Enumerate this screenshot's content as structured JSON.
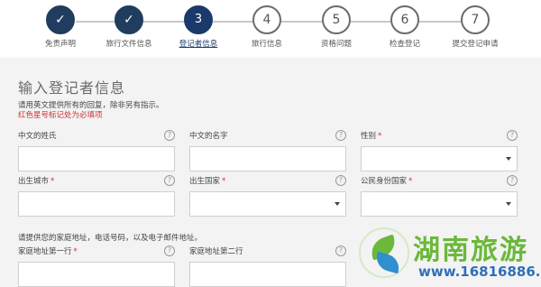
{
  "steps": [
    {
      "number": "✓",
      "label": "免责声明",
      "state": "done"
    },
    {
      "number": "✓",
      "label": "旅行文件信息",
      "state": "done"
    },
    {
      "number": "3",
      "label": "登记者信息",
      "state": "current"
    },
    {
      "number": "4",
      "label": "旅行信息",
      "state": "pending"
    },
    {
      "number": "5",
      "label": "资格问题",
      "state": "pending"
    },
    {
      "number": "6",
      "label": "检查登记",
      "state": "pending"
    },
    {
      "number": "7",
      "label": "提交登记申请",
      "state": "pending"
    }
  ],
  "form": {
    "title": "输入登记者信息",
    "instruction": "请用英文提供所有的回复，除非另有指示。",
    "required_note": "红色星号标记处为必填项",
    "address_note": "请提供您的家庭地址，电话号码，以及电子邮件地址。",
    "fields": {
      "chinese_surname": {
        "label": "中文的姓氏",
        "required": ""
      },
      "chinese_given_name": {
        "label": "中文的名字",
        "required": ""
      },
      "gender": {
        "label": "性别",
        "required": "*"
      },
      "birth_city": {
        "label": "出生城市",
        "required": "*"
      },
      "birth_country": {
        "label": "出生国家",
        "required": "*"
      },
      "citizenship_country": {
        "label": "公民身份国家",
        "required": "*"
      },
      "address_line1": {
        "label": "家庭地址第一行",
        "required": "*"
      },
      "address_line2": {
        "label": "家庭地址第二行",
        "required": ""
      }
    },
    "help_glyph": "?"
  },
  "watermark": {
    "brand": "湖南旅游",
    "url": "www.16816886.cn"
  },
  "colors": {
    "step_done": "#203c5e",
    "step_current": "#1b3a6b",
    "required_red": "#d32f2f",
    "form_bg": "#f3f3f3"
  }
}
